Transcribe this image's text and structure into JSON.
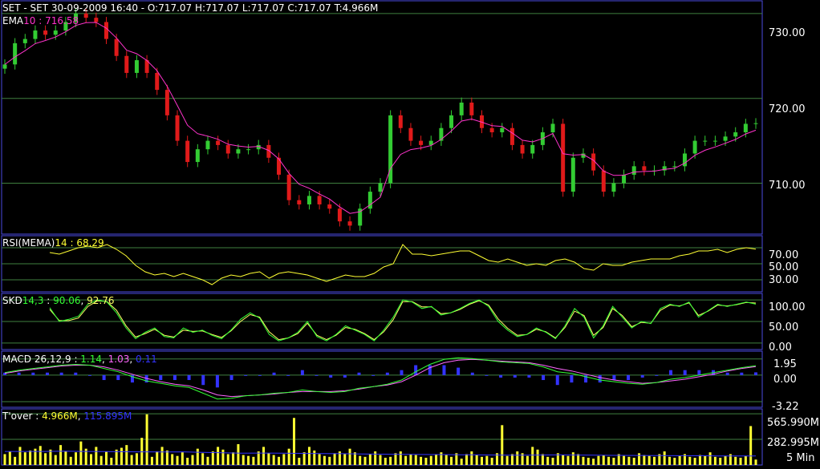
{
  "colors": {
    "background": "#000000",
    "frame": "#4a4ae0",
    "grid": "#3f7f3f",
    "up": "#33cc33",
    "down": "#e01a1a",
    "ema": "#ff33cc",
    "rsi": "#ffff33",
    "skd_k": "#33ff33",
    "skd_d": "#ffff66",
    "macd": "#33ff33",
    "signal": "#ff66ff",
    "hist": "#3333ff",
    "volume": "#ffff33",
    "volume_ma": "#3333ff",
    "axis_text": "#ffffff"
  },
  "header": {
    "text": "SET - SET 30-09-2009 16:40 - O:717.07 H:717.07 L:717.07 C:717.07 T:4.966M"
  },
  "timeframe": "5 Min",
  "chart_data": [
    {
      "id": "price",
      "type": "candlestick",
      "name": "SET",
      "interval": "5 Min",
      "open": 717.07,
      "high": 717.07,
      "low": 717.07,
      "close": 717.07,
      "turnover": "4.966M",
      "indicator": {
        "label": "EMA",
        "param": "10",
        "value": "716.58"
      },
      "y_ticks": [
        "730.00",
        "720.00",
        "710.00"
      ],
      "ylim": [
        704,
        731.5
      ],
      "close_path": [
        724,
        726.5,
        727,
        728,
        727.5,
        728,
        729,
        730,
        729.5,
        729,
        727,
        725,
        723,
        724.5,
        723,
        721,
        718,
        715,
        712.5,
        714,
        715,
        714.5,
        713.5,
        714,
        714,
        714.5,
        713,
        711,
        708,
        707.5,
        708.5,
        707.5,
        707,
        705.5,
        705,
        707,
        709,
        710,
        718,
        716.5,
        715,
        714.5,
        715,
        716.5,
        718,
        719.5,
        718,
        716.5,
        716,
        716.5,
        714.5,
        713.5,
        714.5,
        716,
        717,
        709,
        713,
        713.5,
        711.5,
        709,
        710,
        711,
        712,
        711.5,
        711.5,
        712,
        712,
        713.5,
        715,
        715,
        715,
        715.5,
        716,
        717,
        717.07
      ]
    },
    {
      "id": "rsi",
      "type": "line",
      "label": "RSI(MEMA)",
      "param": "14",
      "value": "68.29",
      "y_ticks": [
        "70.00",
        "50.00",
        "30.00"
      ],
      "ylim": [
        15,
        85
      ],
      "values": [
        64,
        62,
        66,
        70,
        72,
        70,
        74,
        68,
        60,
        48,
        40,
        36,
        38,
        34,
        38,
        34,
        30,
        24,
        32,
        36,
        34,
        38,
        40,
        32,
        38,
        40,
        38,
        36,
        32,
        28,
        32,
        36,
        34,
        34,
        38,
        46,
        50,
        74,
        62,
        62,
        60,
        62,
        64,
        66,
        66,
        60,
        54,
        52,
        56,
        52,
        48,
        50,
        48,
        54,
        56,
        52,
        44,
        42,
        50,
        48,
        48,
        52,
        54,
        56,
        56,
        56,
        60,
        62,
        66,
        66,
        68,
        64,
        68,
        70,
        68.29
      ]
    },
    {
      "id": "skd",
      "type": "line",
      "label": "SKD",
      "param": "14,3",
      "values_text": [
        "90.06",
        "92.76"
      ],
      "y_ticks": [
        "100.00",
        "50.00",
        "0.00"
      ],
      "ylim": [
        -15,
        115
      ],
      "k": [
        82,
        50,
        55,
        62,
        90,
        100,
        95,
        70,
        35,
        10,
        25,
        35,
        15,
        12,
        35,
        25,
        30,
        18,
        10,
        30,
        55,
        70,
        58,
        20,
        5,
        12,
        25,
        50,
        15,
        5,
        20,
        40,
        30,
        20,
        5,
        30,
        60,
        100,
        95,
        80,
        85,
        65,
        70,
        80,
        92,
        100,
        85,
        50,
        30,
        15,
        20,
        35,
        25,
        10,
        40,
        80,
        60,
        12,
        40,
        85,
        60,
        35,
        50,
        45,
        80,
        90,
        85,
        95,
        60,
        75,
        90,
        85,
        90,
        95,
        90.06
      ],
      "d": [
        78,
        52,
        52,
        58,
        85,
        98,
        96,
        76,
        40,
        14,
        22,
        32,
        18,
        14,
        30,
        27,
        28,
        20,
        13,
        28,
        50,
        66,
        60,
        26,
        8,
        12,
        22,
        46,
        18,
        8,
        18,
        36,
        32,
        22,
        8,
        26,
        54,
        96,
        96,
        84,
        84,
        68,
        70,
        78,
        90,
        98,
        88,
        56,
        34,
        18,
        20,
        32,
        26,
        12,
        36,
        74,
        64,
        18,
        36,
        80,
        64,
        38,
        48,
        46,
        76,
        88,
        86,
        93,
        64,
        74,
        88,
        86,
        89,
        94,
        92.76
      ]
    },
    {
      "id": "macd",
      "type": "line",
      "label": "MACD",
      "param": "26,12,9",
      "values_text": [
        "1.14",
        "1.03",
        "0.11"
      ],
      "y_ticks": [
        "1.95",
        "0.00",
        "-3.22"
      ],
      "ylim": [
        -3.9,
        2.9
      ],
      "macd": [
        0.3,
        0.6,
        0.8,
        1.0,
        1.2,
        1.3,
        1.2,
        0.8,
        0.4,
        -0.2,
        -0.7,
        -1.0,
        -1.3,
        -1.5,
        -2.2,
        -2.9,
        -2.8,
        -2.5,
        -2.4,
        -2.2,
        -2.1,
        -1.8,
        -2.0,
        -2.1,
        -2.0,
        -1.6,
        -1.4,
        -1.1,
        -0.6,
        0.4,
        1.3,
        1.9,
        2.1,
        2.0,
        1.8,
        1.6,
        1.5,
        1.4,
        1.0,
        0.4,
        0.2,
        -0.2,
        -0.6,
        -0.8,
        -1.0,
        -1.1,
        -0.9,
        -0.5,
        -0.3,
        0.0,
        0.3,
        0.6,
        0.9,
        1.14
      ],
      "signal": [
        0.2,
        0.5,
        0.7,
        0.9,
        1.1,
        1.2,
        1.2,
        1.0,
        0.6,
        0.1,
        -0.4,
        -0.8,
        -1.1,
        -1.3,
        -1.8,
        -2.4,
        -2.6,
        -2.5,
        -2.4,
        -2.3,
        -2.1,
        -2.0,
        -2.0,
        -2.0,
        -1.9,
        -1.7,
        -1.4,
        -1.2,
        -0.8,
        0.0,
        0.9,
        1.5,
        1.8,
        1.9,
        1.8,
        1.7,
        1.6,
        1.5,
        1.2,
        0.8,
        0.5,
        0.1,
        -0.3,
        -0.6,
        -0.8,
        -1.0,
        -0.9,
        -0.7,
        -0.5,
        -0.2,
        0.1,
        0.5,
        0.8,
        1.03
      ]
    },
    {
      "id": "volume",
      "type": "bar",
      "label": "T'over",
      "values_text": [
        "4.966M",
        "115.895M"
      ],
      "y_ticks": [
        "565.990M",
        "282.995M"
      ],
      "ylim": [
        0,
        620
      ],
      "bars": [
        120,
        150,
        90,
        200,
        140,
        160,
        180,
        210,
        130,
        170,
        110,
        220,
        150,
        90,
        140,
        260,
        180,
        120,
        200,
        100,
        150,
        80,
        170,
        190,
        220,
        110,
        130,
        300,
        560,
        90,
        150,
        200,
        160,
        120,
        100,
        140,
        80,
        110,
        180,
        130,
        90,
        150,
        200,
        170,
        120,
        140,
        230,
        110,
        100,
        90,
        150,
        200,
        130,
        110,
        90,
        120,
        180,
        520,
        80,
        140,
        200,
        160,
        120,
        100,
        90,
        130,
        150,
        120,
        180,
        140,
        100,
        90,
        120,
        150,
        110,
        80,
        90,
        130,
        150,
        100,
        120,
        110,
        90,
        80,
        100,
        120,
        140,
        110,
        90,
        130,
        70,
        120,
        150,
        110,
        90,
        100,
        80,
        130,
        440,
        100,
        120,
        150,
        130,
        100,
        200,
        170,
        120,
        90,
        80,
        130,
        110,
        100,
        140,
        120,
        90,
        80,
        70,
        100,
        110,
        90,
        80,
        120,
        100,
        90,
        80,
        130,
        110,
        100,
        90,
        120,
        150,
        90,
        80,
        100,
        120,
        90,
        80,
        110,
        100,
        140,
        90,
        80,
        100,
        120,
        90,
        80,
        100,
        430,
        60
      ],
      "ma": [
        150,
        150,
        150,
        152,
        150,
        148,
        146,
        145,
        144,
        145,
        140,
        135,
        130,
        132,
        130,
        128,
        126,
        125,
        122,
        120,
        118,
        116,
        115,
        113,
        112,
        110,
        108,
        110,
        112,
        110,
        108,
        106,
        105,
        104,
        103,
        102,
        100,
        100,
        100
      ]
    }
  ]
}
